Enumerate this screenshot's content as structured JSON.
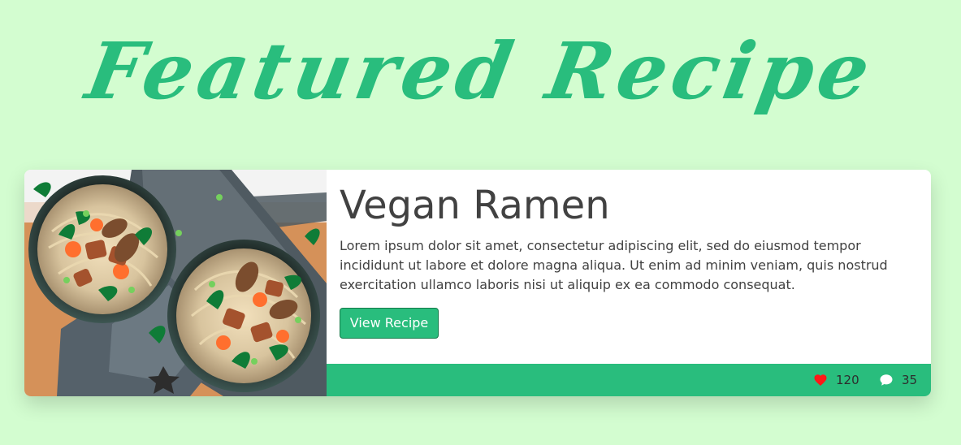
{
  "header": {
    "title": "Featured Recipe"
  },
  "recipe_card": {
    "image": {
      "icon": "vegan-ramen-bowl-image"
    },
    "title": "Vegan Ramen",
    "description": "Lorem ipsum dolor sit amet, consectetur adipiscing elit, sed do eiusmod tempor incididunt ut labore et dolore magna aliqua. Ut enim ad minim veniam, quis nostrud exercitation ullamco laboris nisi ut aliquip ex ea commodo consequat.",
    "button_label": "View Recipe",
    "footer": {
      "likes": "120",
      "comments": "35",
      "likes_icon": "heart-icon",
      "comments_icon": "comment-icon"
    }
  },
  "colors": {
    "background": "#d3fdd0",
    "accent": "#29bd7d",
    "card": "#ffffff",
    "heart": "#ff1717"
  }
}
